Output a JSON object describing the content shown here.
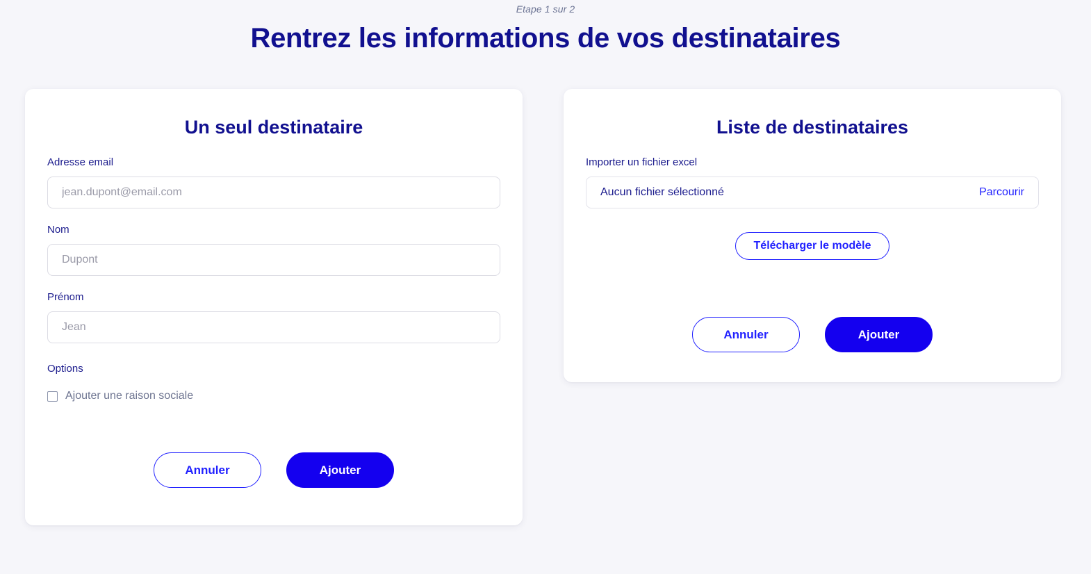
{
  "header": {
    "step": "Etape 1 sur 2",
    "title": "Rentrez les informations de vos destinataires"
  },
  "single_recipient_card": {
    "title": "Un seul destinataire",
    "fields": [
      {
        "label": "Adresse email",
        "value": "",
        "placeholder": "jean.dupont@email.com"
      },
      {
        "label": "Nom",
        "value": "",
        "placeholder": "Dupont"
      },
      {
        "label": "Prénom",
        "value": "",
        "placeholder": "Jean"
      }
    ],
    "options_label": "Options",
    "checkbox": {
      "label": "Ajouter une raison sociale",
      "checked": false
    },
    "cancel_label": "Annuler",
    "submit_label": "Ajouter"
  },
  "recipient_list_card": {
    "title": "Liste de destinataires",
    "import_label": "Importer un fichier excel",
    "file_name": "Aucun fichier sélectionné",
    "browse_label": "Parcourir",
    "template_label": "Télécharger le modèle",
    "cancel_label": "Annuler",
    "submit_label": "Ajouter"
  },
  "colors": {
    "page_background": "#f6f6fa",
    "card_background": "#ffffff",
    "navy": "#11108f",
    "accent_blue": "#2121ff",
    "primary_button": "#1400ef",
    "muted_text": "#6e7591",
    "placeholder": "#9a9aa8",
    "input_border": "#dcdce4"
  }
}
